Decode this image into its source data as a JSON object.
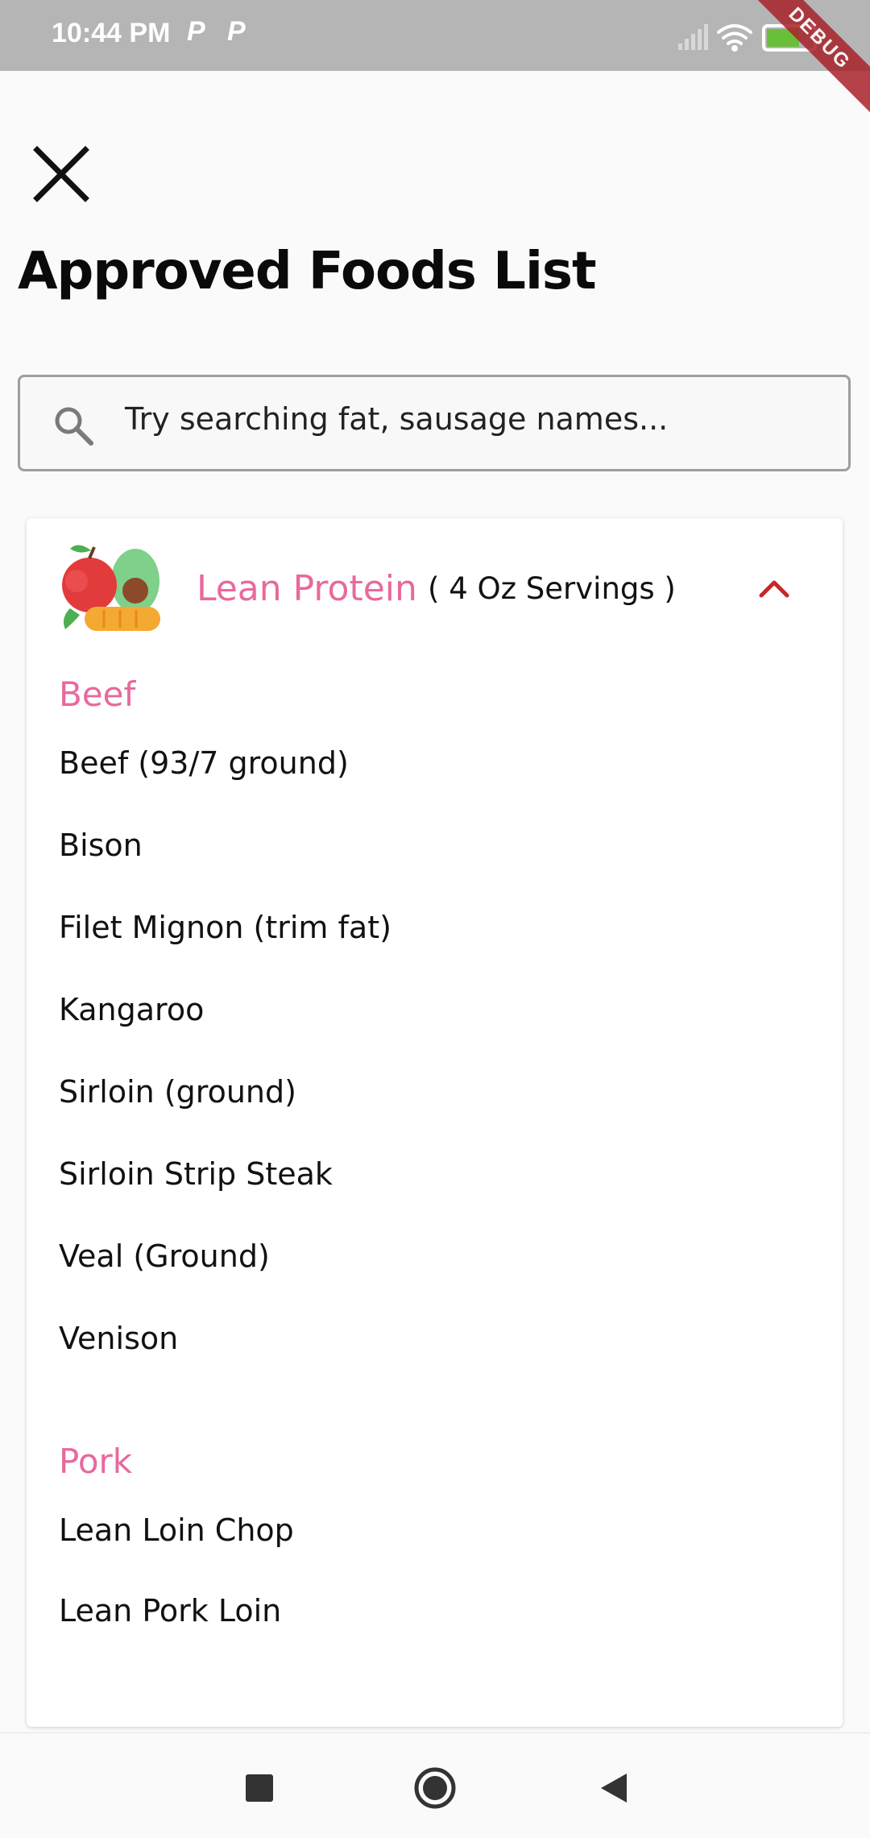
{
  "status_bar": {
    "time": "10:44 PM",
    "notif_1": "P",
    "notif_2": "P",
    "battery": "71",
    "debug_label": "DEBUG",
    "icons": [
      "signal-icon",
      "wifi-icon",
      "battery-icon"
    ]
  },
  "header": {
    "close_icon": "close-icon",
    "title": "Approved Foods List"
  },
  "search": {
    "icon": "search-icon",
    "placeholder": "Try searching fat, sausage names..."
  },
  "category": {
    "name": "Lean Protein",
    "serving": "( 4 Oz Servings )",
    "icon": "fruit-vegetable-icon",
    "chevron": "chevron-up-icon",
    "accent_color": "#e8699e",
    "chevron_color": "#c62828",
    "sections": [
      {
        "title": "Beef",
        "items": [
          "Beef (93/7 ground)",
          "Bison",
          "Filet Mignon (trim fat)",
          "Kangaroo",
          "Sirloin (ground)",
          "Sirloin Strip Steak",
          "Veal (Ground)",
          "Venison"
        ]
      },
      {
        "title": "Pork",
        "items": [
          "Lean Loin Chop",
          "Lean Pork Loin"
        ]
      }
    ]
  },
  "nav_bar": {
    "buttons": [
      "recents-square-icon",
      "home-circle-icon",
      "back-triangle-icon"
    ]
  }
}
